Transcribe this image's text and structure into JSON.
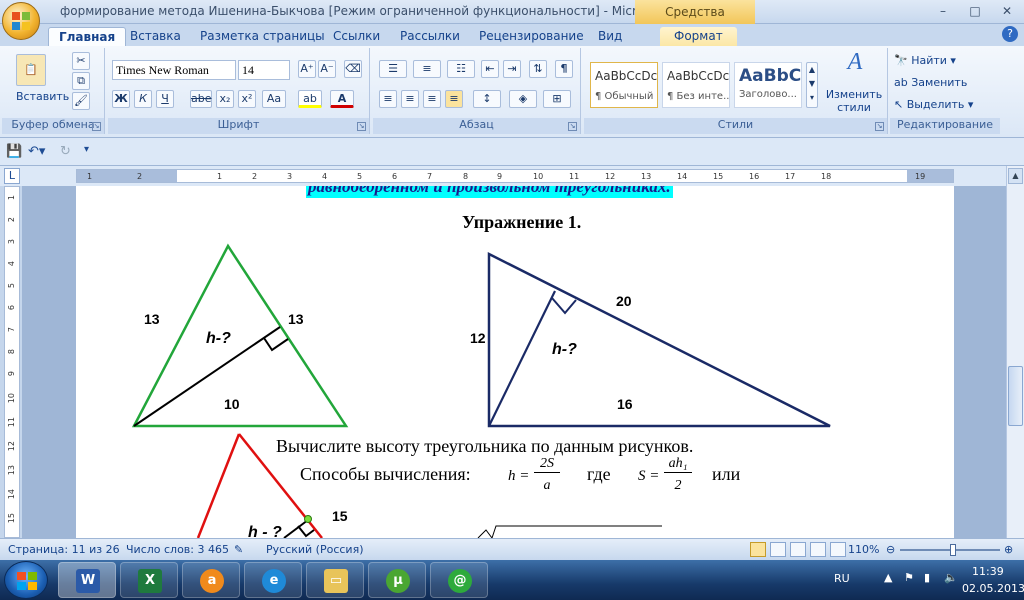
{
  "window": {
    "title": "формирование метода Ишенина-Быкчова [Режим ограниченной функциональности] - Microsoft W...",
    "tools_context": "Средства рисования",
    "controls": [
      "–",
      "□",
      "✕"
    ]
  },
  "tabs": [
    {
      "label": "Главная",
      "active": true
    },
    {
      "label": "Вставка"
    },
    {
      "label": "Разметка страницы"
    },
    {
      "label": "Ссылки"
    },
    {
      "label": "Рассылки"
    },
    {
      "label": "Рецензирование"
    },
    {
      "label": "Вид"
    },
    {
      "label": "Формат"
    }
  ],
  "ribbon": {
    "clipboard": {
      "label": "Буфер обмена",
      "paste": "Вставить"
    },
    "font": {
      "label": "Шрифт",
      "family": "Times New Roman",
      "size": "14",
      "bold": "Ж",
      "italic": "К",
      "underline": "Ч",
      "strike": "abe",
      "sub": "x₂",
      "sup": "x²",
      "case": "Aa",
      "grow": "A⁺",
      "shrink": "A⁻"
    },
    "paragraph": {
      "label": "Абзац",
      "pilcrow": "¶"
    },
    "styles": {
      "label": "Стили",
      "items": [
        {
          "sample": "AaBbCcDc",
          "name": "¶ Обычный"
        },
        {
          "sample": "AaBbCcDc",
          "name": "¶ Без инте..."
        },
        {
          "sample": "AaBbC",
          "name": "Заголово..."
        }
      ],
      "change": "Изменить стили"
    },
    "editing": {
      "label": "Редактирование",
      "find": "Найти",
      "replace": "Заменить",
      "select": "Выделить"
    }
  },
  "ruler": {
    "h_numbers": [
      "1",
      "2",
      "1",
      "2",
      "3",
      "4",
      "5",
      "6",
      "7",
      "8",
      "9",
      "10",
      "11",
      "12",
      "13",
      "14",
      "15",
      "16",
      "17",
      "18",
      "19"
    ],
    "v_numbers": [
      "1",
      "2",
      "3",
      "4",
      "5",
      "6",
      "7",
      "8",
      "9",
      "10",
      "11",
      "12",
      "13",
      "14",
      "15"
    ]
  },
  "document": {
    "heading_cut": "равнобедренном и произвольном треугольниках.",
    "exercise": "Упражнение 1.",
    "tri1": {
      "left": "13",
      "right": "13",
      "base": "10",
      "h": "h-?"
    },
    "tri2": {
      "left": "12",
      "hyp": "20",
      "base": "16",
      "h": "h-?"
    },
    "tri3": {
      "side": "15",
      "h": "h - ?"
    },
    "line1": "Вычислите высоту треугольника по данным рисунков.",
    "line2": "Способы вычисления:",
    "formula1": {
      "lhs": "h =",
      "num": "2S",
      "den": "a"
    },
    "where": "где",
    "formula2": {
      "lhs": "S =",
      "num": "ah₁",
      "den": "2"
    },
    "or": "или"
  },
  "status": {
    "page": "Страница: 11 из 26",
    "words": "Число слов: 3 465",
    "lang": "Русский (Россия)",
    "zoom": "110%"
  },
  "taskbar": {
    "apps": [
      "word-icon",
      "excel-icon",
      "avast-icon",
      "ie-icon",
      "explorer-icon",
      "utorrent-icon",
      "mailru-agent-icon"
    ],
    "lang": "RU",
    "time": "11:39",
    "date": "02.05.2013"
  }
}
